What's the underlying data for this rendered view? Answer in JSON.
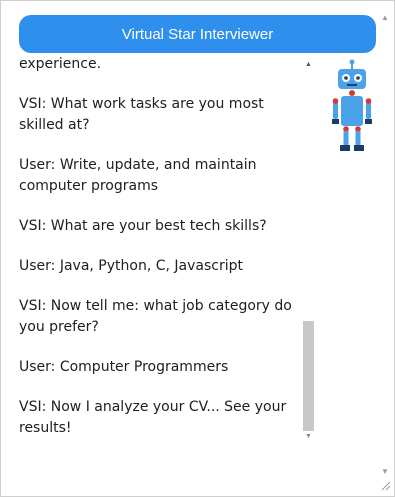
{
  "header": {
    "title": "Virtual Star Interviewer"
  },
  "chat": {
    "messages": [
      "VSI: Please tell me your work experience.",
      "VSI: What work tasks are you most skilled at?",
      "User: Write, update, and maintain computer programs",
      "VSI: What are your best tech skills?",
      "User: Java, Python, C, Javascript",
      "VSI: Now tell me: what job category do you prefer?",
      "User: Computer Programmers",
      "VSI: Now I analyze your CV... See your results!"
    ]
  },
  "icons": {
    "robot": "robot-icon",
    "scroll_up": "arrow-up-icon",
    "scroll_down": "arrow-down-icon",
    "resize": "resize-grip-icon"
  },
  "colors": {
    "header_bg": "#2f8fec",
    "robot_body": "#4aa3e8",
    "robot_joints": "#e0343a"
  }
}
